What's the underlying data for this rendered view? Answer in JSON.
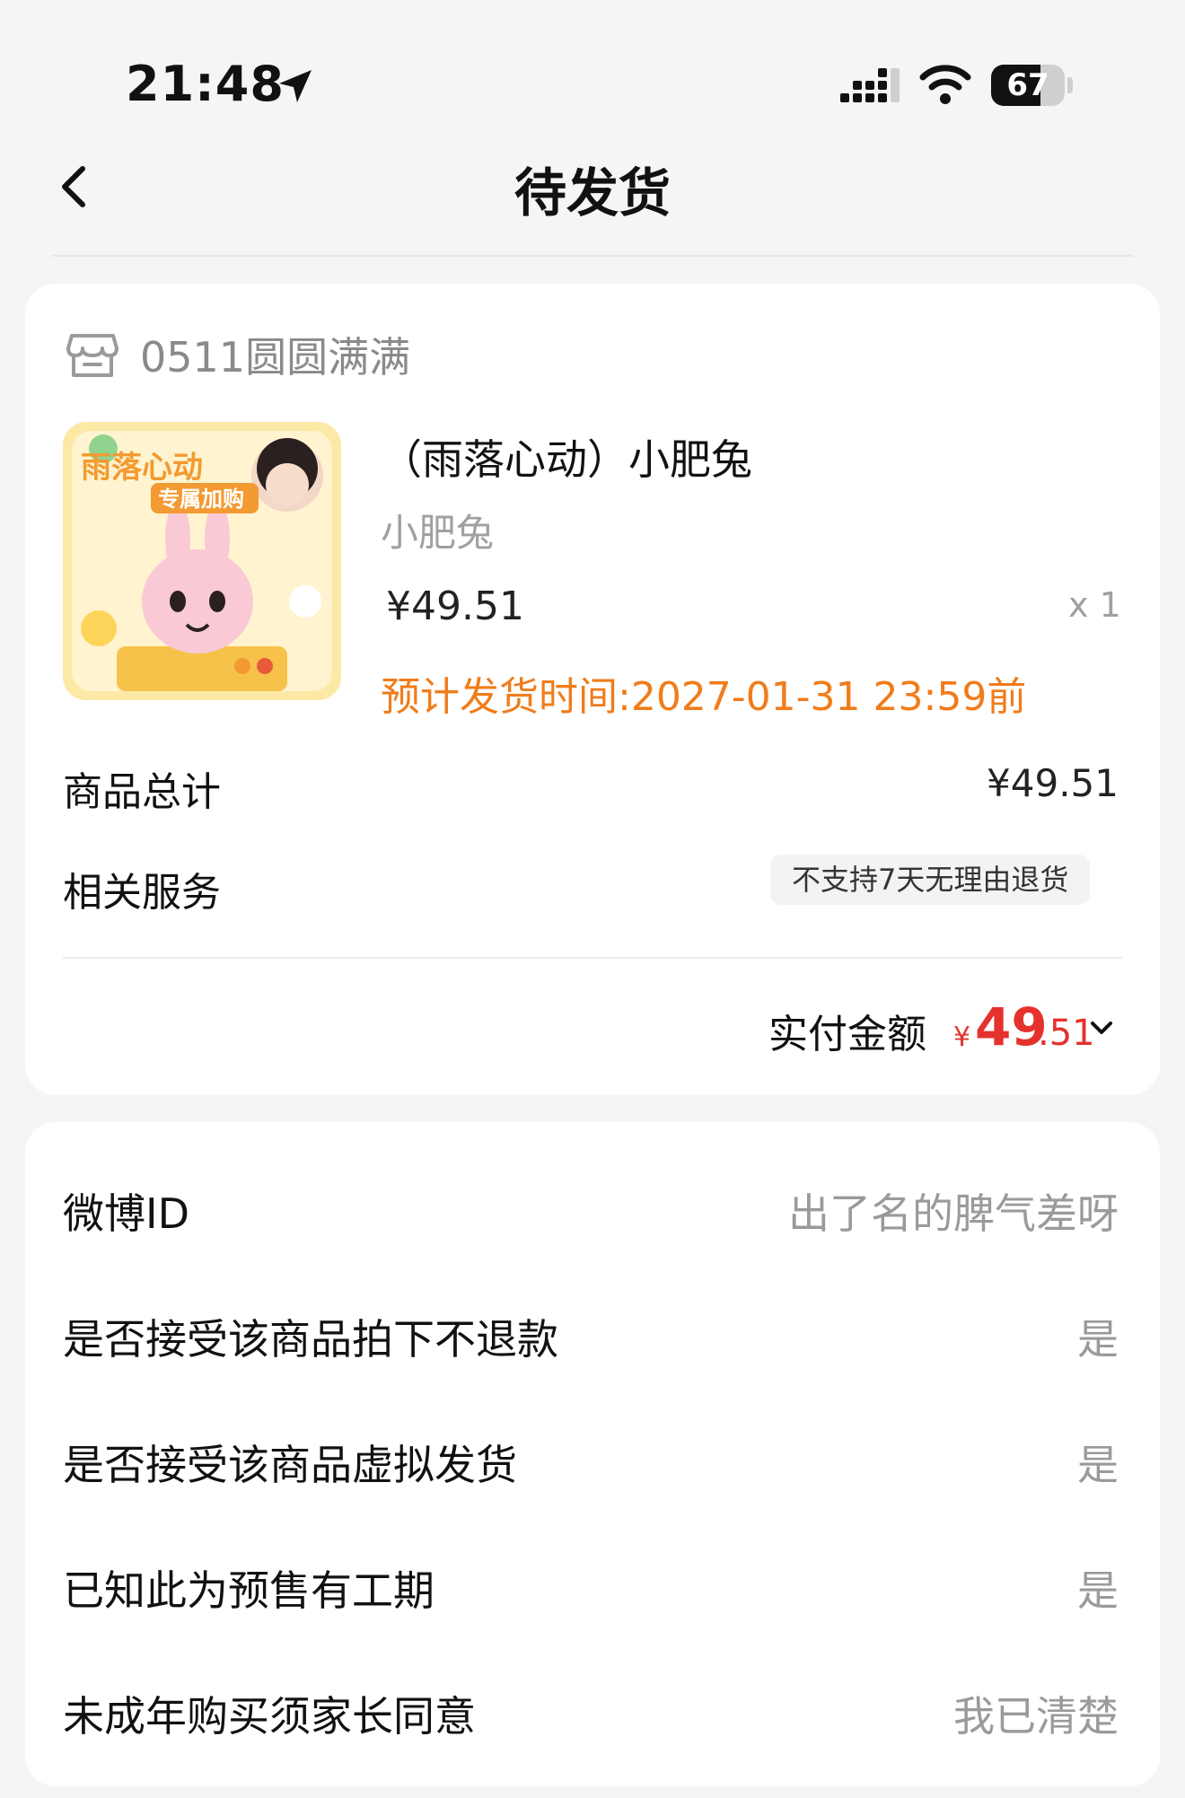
{
  "status_bar": {
    "time": "21:48",
    "battery": "67",
    "battery_level_percent": 67
  },
  "nav": {
    "title": "待发货"
  },
  "store": {
    "name": "0511圆圆满满"
  },
  "product": {
    "title": "（雨落心动）小肥兔",
    "spec": "小肥兔",
    "price": "¥49.51",
    "qty": "x 1",
    "ship_time": "预计发货时间:2027-01-31 23:59前",
    "image_text": [
      "雨落心动",
      "专属加购"
    ]
  },
  "summary": {
    "total_label": "商品总计",
    "total_value": "¥49.51",
    "service_label": "相关服务",
    "service_tag": "不支持7天无理由退货",
    "paid_label": "实付金额",
    "paid_symbol": "¥",
    "paid_int": "49",
    "paid_dec": ".51"
  },
  "info_rows": [
    {
      "label": "微博ID",
      "value": "出了名的脾气差呀"
    },
    {
      "label": "是否接受该商品拍下不退款",
      "value": "是"
    },
    {
      "label": "是否接受该商品虚拟发货",
      "value": "是"
    },
    {
      "label": "已知此为预售有工期",
      "value": "是"
    },
    {
      "label": "未成年购买须家长同意",
      "value": "我已清楚"
    }
  ],
  "colors": {
    "accent_orange": "#f07c1a",
    "price_red": "#e5322d"
  }
}
